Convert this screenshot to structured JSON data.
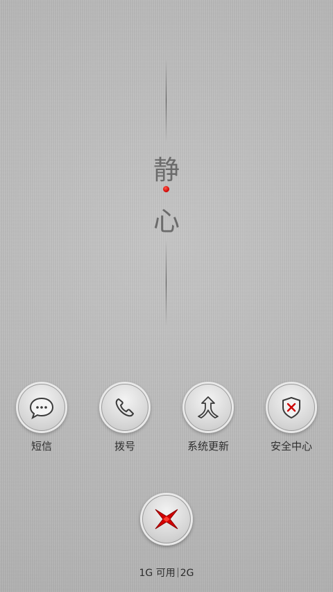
{
  "wallpaper": {
    "char_top": "静",
    "char_bottom": "心",
    "dot_color": "#cc0000"
  },
  "apps": [
    {
      "label": "短信",
      "icon": "message-icon"
    },
    {
      "label": "拨号",
      "icon": "phone-icon"
    },
    {
      "label": "系统更新",
      "icon": "update-arrows-icon"
    },
    {
      "label": "安全中心",
      "icon": "shield-icon"
    }
  ],
  "center_button": {
    "icon": "close-x-icon",
    "color": "#d40000"
  },
  "memory": {
    "used": "1G",
    "available_label": "可用",
    "total": "2G"
  }
}
